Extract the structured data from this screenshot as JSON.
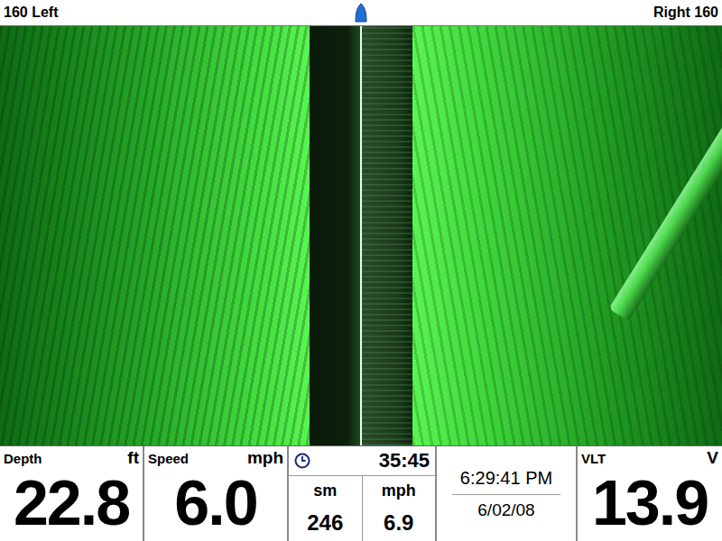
{
  "top_bar": {
    "left_label": "160 Left",
    "right_label": "Right 160"
  },
  "readouts": [
    {
      "kind": "big",
      "label": "Depth",
      "unit": "ft",
      "value": "22.8"
    },
    {
      "kind": "big",
      "label": "Speed",
      "unit": "mph",
      "value": "6.0"
    },
    {
      "kind": "timer",
      "time": "35:45",
      "units": [
        "sm",
        "mph"
      ],
      "values": [
        "246",
        "6.9"
      ]
    },
    {
      "kind": "clock",
      "time": "6:29:41 PM",
      "date": "6/02/08"
    },
    {
      "kind": "big",
      "label": "VLT",
      "unit": "V",
      "value": "13.9"
    }
  ]
}
